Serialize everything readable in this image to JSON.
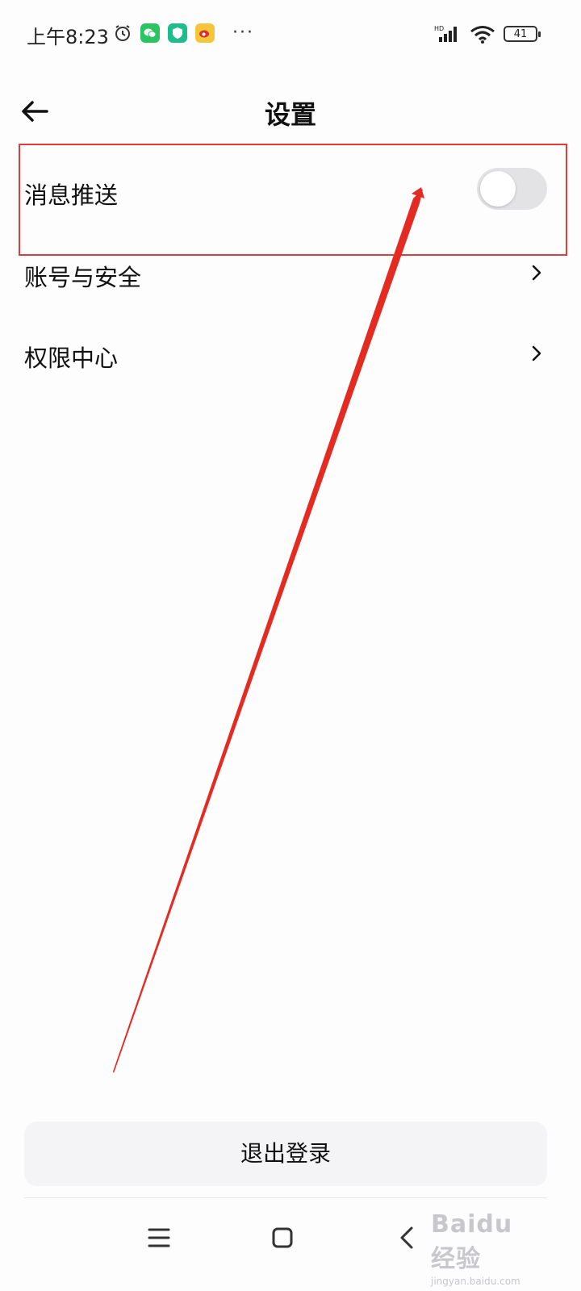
{
  "status_bar": {
    "time": "上午8:23",
    "more": "···",
    "battery": "41",
    "network": "HD"
  },
  "header": {
    "title": "设置"
  },
  "settings": {
    "items": [
      {
        "label": "消息推送",
        "type": "toggle",
        "on": false
      },
      {
        "label": "账号与安全",
        "type": "link"
      },
      {
        "label": "权限中心",
        "type": "link"
      }
    ]
  },
  "logout": {
    "label": "退出登录"
  },
  "watermark": {
    "main": "Baidu经验",
    "sub": "jingyan.baidu.com"
  },
  "colors": {
    "annotation": "#e23b3b",
    "toggle_off": "#e3e3e5",
    "button_bg": "#f4f4f6"
  }
}
